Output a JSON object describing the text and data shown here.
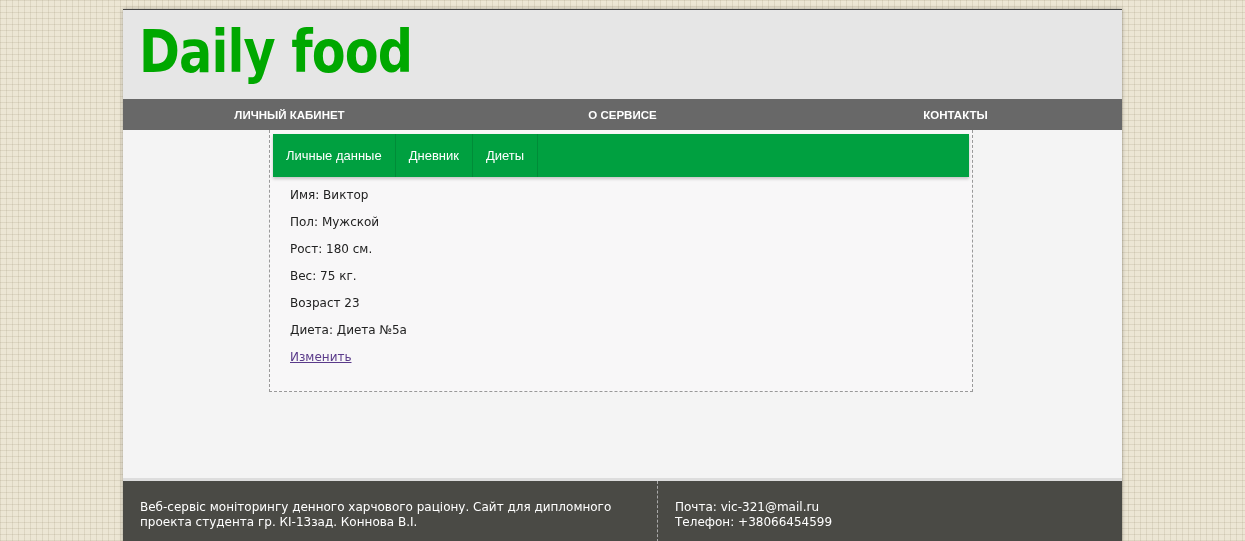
{
  "logo": "Daily food",
  "nav": [
    "ЛИЧНЫЙ КАБИНЕТ",
    "О СЕРВИСЕ",
    "КОНТАКТЫ"
  ],
  "tabs": [
    "Личные данные",
    "Дневник",
    "Диеты"
  ],
  "profile": [
    "Имя: Виктор",
    "Пол: Мужской",
    "Рост: 180 см.",
    "Вес: 75 кг.",
    "Возраст 23",
    "Диета: Диета №5а"
  ],
  "edit_link": "Изменить",
  "footer": {
    "about": "Веб-сервіс моніторингу денного харчового раціону. Сайт для дипломного проекта студента гр. КІ-13зад. Коннова В.І.",
    "contacts": [
      "Почта: vic-321@mail.ru",
      "Телефон: +38066454599"
    ]
  }
}
